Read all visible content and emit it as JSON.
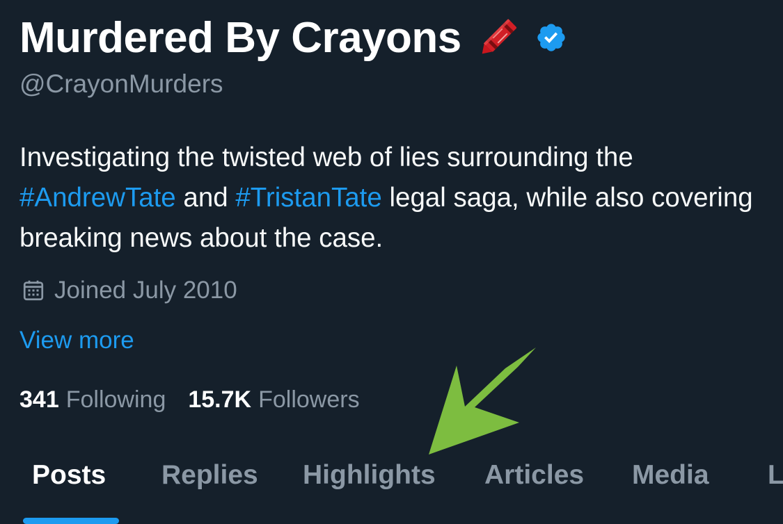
{
  "profile": {
    "display_name": "Murdered By Crayons",
    "handle": "@CrayonMurders",
    "bio": {
      "part1": "Investigating the twisted web of lies surrounding the ",
      "hashtag1": "#AndrewTate",
      "part2": " and ",
      "hashtag2": "#TristanTate",
      "part3": " legal saga, while also covering breaking news about the case."
    },
    "joined": "Joined July 2010",
    "view_more": "View more",
    "icons": {
      "name_emoji": "crayon-icon",
      "verified": "verified-badge-icon",
      "joined": "calendar-icon"
    }
  },
  "stats": {
    "following_count": "341",
    "following_label": "Following",
    "followers_count": "15.7K",
    "followers_label": "Followers"
  },
  "tabs": [
    {
      "label": "Posts",
      "active": true
    },
    {
      "label": "Replies",
      "active": false
    },
    {
      "label": "Highlights",
      "active": false
    },
    {
      "label": "Articles",
      "active": false
    },
    {
      "label": "Media",
      "active": false
    },
    {
      "label": "L",
      "active": false
    }
  ],
  "colors": {
    "background": "#15202b",
    "primary_text": "#f7f9f9",
    "secondary_text": "#8b98a5",
    "accent": "#1d9bf0",
    "annotation_arrow": "#7dbd40"
  }
}
